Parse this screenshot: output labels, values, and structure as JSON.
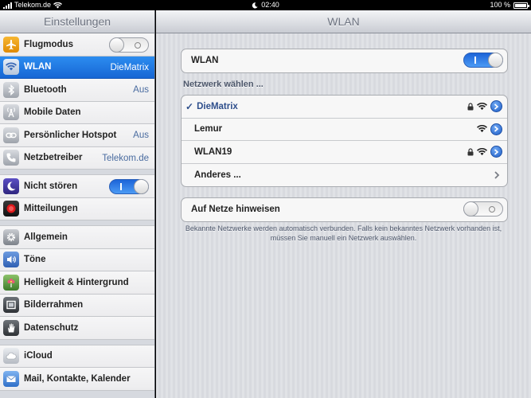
{
  "status_bar": {
    "carrier": "Telekom.de",
    "time": "02:40",
    "battery": "100 %"
  },
  "sidebar": {
    "title": "Einstellungen",
    "items": [
      {
        "label": "Flugmodus",
        "value": "",
        "toggle": "off",
        "icon": "airplane-icon",
        "color": "#f2a31b"
      },
      {
        "label": "WLAN",
        "value": "DieMatrix",
        "selected": true,
        "icon": "wifi-icon",
        "color": "#4a90e2"
      },
      {
        "label": "Bluetooth",
        "value": "Aus",
        "icon": "bluetooth-icon",
        "color": "#8e9299"
      },
      {
        "label": "Mobile Daten",
        "value": "",
        "icon": "antenna-icon",
        "color": "#8e9299"
      },
      {
        "label": "Persönlicher Hotspot",
        "value": "Aus",
        "icon": "chain-link-icon",
        "color": "#8e9299"
      },
      {
        "label": "Netzbetreiber",
        "value": "Telekom.de",
        "icon": "phone-icon",
        "color": "#8e9299"
      },
      {
        "label": "Nicht stören",
        "value": "",
        "toggle": "on",
        "icon": "moon-icon",
        "color": "#4b3fa6"
      },
      {
        "label": "Mitteilungen",
        "value": "",
        "icon": "notifications-icon",
        "color": "#d0021b"
      },
      {
        "label": "Allgemein",
        "value": "",
        "icon": "gear-icon",
        "color": "#8e9299"
      },
      {
        "label": "Töne",
        "value": "",
        "icon": "speaker-icon",
        "color": "#4a76c9"
      },
      {
        "label": "Helligkeit & Hintergrund",
        "value": "",
        "icon": "flower-icon",
        "color": "#6aa84f"
      },
      {
        "label": "Bilderrahmen",
        "value": "",
        "icon": "picture-frame-icon",
        "color": "#555a60"
      },
      {
        "label": "Datenschutz",
        "value": "",
        "icon": "hand-icon",
        "color": "#555a60"
      },
      {
        "label": "iCloud",
        "value": "",
        "icon": "cloud-icon",
        "color": "#8e9299"
      },
      {
        "label": "Mail, Kontakte, Kalender",
        "value": "",
        "icon": "mail-icon",
        "color": "#4a90e2"
      }
    ]
  },
  "detail": {
    "title": "WLAN",
    "wlan_label": "WLAN",
    "wlan_toggle": "on",
    "section_header": "Netzwerk wählen ...",
    "networks": [
      {
        "name": "DieMatrix",
        "connected": true,
        "locked": true
      },
      {
        "name": "Lemur",
        "connected": false,
        "locked": false
      },
      {
        "name": "WLAN19",
        "connected": false,
        "locked": true
      }
    ],
    "other_label": "Anderes ...",
    "ask_label": "Auf Netze hinweisen",
    "ask_toggle": "off",
    "footer_note": "Bekannte Netzwerke werden automatisch verbunden. Falls kein bekanntes Netzwerk vorhanden ist, müssen Sie manuell ein Netzwerk auswählen."
  },
  "colors": {
    "accent": "#1f78e6",
    "checked_text": "#2f4f8c",
    "value_text": "#4a6ca0"
  }
}
